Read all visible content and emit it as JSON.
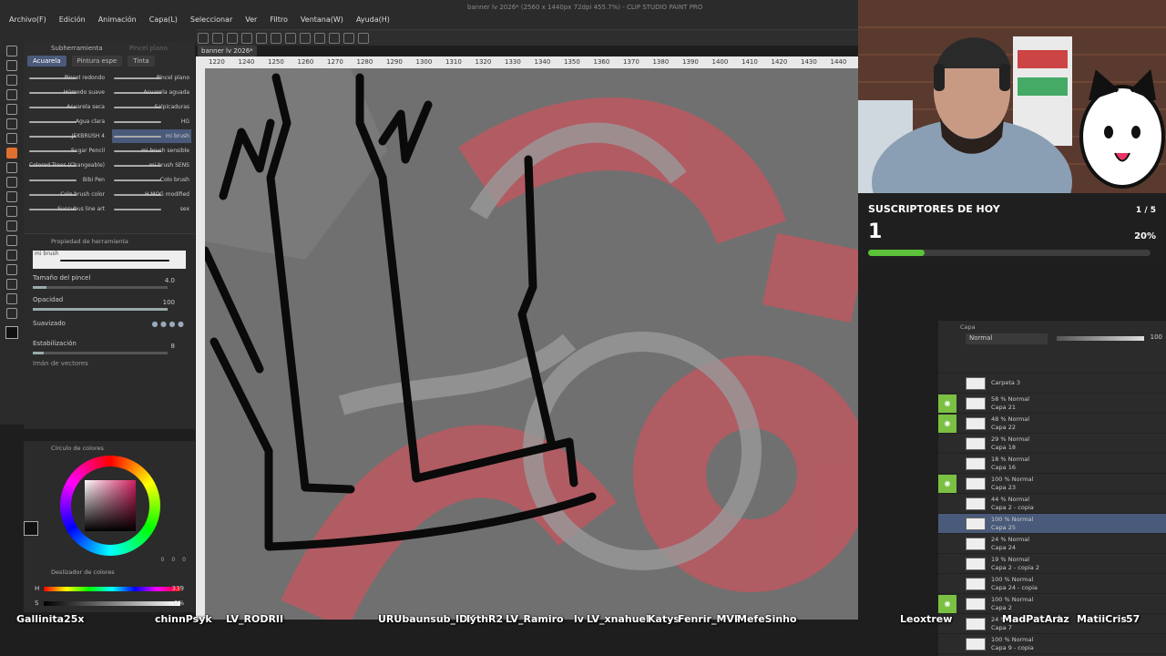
{
  "menubar": {
    "items": [
      "Archivo(F)",
      "Edición",
      "Animación",
      "Capa(L)",
      "Seleccionar",
      "Ver",
      "Filtro",
      "Ventana(W)",
      "Ayuda(H)"
    ],
    "title": "banner lv 2026* (2560 x 1440px 72dpi 455.7%) - CLIP STUDIO PAINT PRO"
  },
  "subtool": {
    "header": "Subherramienta",
    "header2": "Pincel plano",
    "tabs": [
      "Acuarela",
      "Pintura espe",
      "Tinta"
    ],
    "brushes": [
      {
        "label": "Pincel redondo",
        "sel": false
      },
      {
        "label": "Pincel plano",
        "sel": false
      },
      {
        "label": "Húmedo suave",
        "sel": false
      },
      {
        "label": "Acuarela aguada",
        "sel": false
      },
      {
        "label": "Acuarela seca",
        "sel": false
      },
      {
        "label": "Salpicaduras",
        "sel": false
      },
      {
        "label": "Agua clara",
        "sel": false
      },
      {
        "label": "HG",
        "sel": false
      },
      {
        "label": "JEKBRUSH 4",
        "sel": false
      },
      {
        "label": "mi brush",
        "sel": true
      },
      {
        "label": "Sugar Pencil",
        "sel": false
      },
      {
        "label": "mi brush sensible",
        "sel": false
      },
      {
        "label": "Colored Trees (Changeable)",
        "sel": false
      },
      {
        "label": "mi brush SENS",
        "sel": false
      },
      {
        "label": "Bibi Pen",
        "sel": false
      },
      {
        "label": "Colo brush",
        "sel": false
      },
      {
        "label": "Colo brush color",
        "sel": false
      },
      {
        "label": "H.MOG modified",
        "sel": false
      },
      {
        "label": "Succubus line art",
        "sel": false
      },
      {
        "label": "sex",
        "sel": false
      }
    ]
  },
  "toolprop": {
    "header": "Propiedad de herramienta",
    "brush_name": "mi brush",
    "size_label": "Tamaño del pincel",
    "size_value": "4.0",
    "opacity_label": "Opacidad",
    "opacity_value": "100",
    "smooth_label": "Suavizado",
    "stab_label": "Estabilización",
    "stab_value": "8",
    "vector_label": "Imán de vectores"
  },
  "colorwheel": {
    "header": "Círculo de colores",
    "values": [
      "0",
      "0",
      "0"
    ]
  },
  "colorslider": {
    "header": "Deslizador de colores",
    "h_label": "H",
    "s_label": "S",
    "h_value": "339",
    "s_value": "0%"
  },
  "canvas": {
    "doc_tab": "banner lv 2026*",
    "ruler": [
      "1220",
      "1240",
      "1250",
      "1260",
      "1270",
      "1280",
      "1290",
      "1300",
      "1310",
      "1320",
      "1330",
      "1340",
      "1350",
      "1360",
      "1370",
      "1380",
      "1390",
      "1400",
      "1410",
      "1420",
      "1430",
      "1440"
    ]
  },
  "subs": {
    "title": "SUSCRIPTORES DE HOY",
    "count": "1",
    "goal": "1 / 5",
    "percent": "20%",
    "progress": 0.2
  },
  "layers": {
    "panel_title": "Capa",
    "blend_mode": "Normal",
    "opacity": "100",
    "rows": [
      {
        "mode": "",
        "name": "Carpeta 3",
        "eye": false,
        "sel": false
      },
      {
        "mode": "58 % Normal",
        "name": "Capa 21",
        "eye": true,
        "sel": false
      },
      {
        "mode": "48 % Normal",
        "name": "Capa 22",
        "eye": true,
        "sel": false
      },
      {
        "mode": "29 % Normal",
        "name": "Capa 18",
        "eye": false,
        "sel": false
      },
      {
        "mode": "18 % Normal",
        "name": "Capa 16",
        "eye": false,
        "sel": false
      },
      {
        "mode": "100 % Normal",
        "name": "Capa 23",
        "eye": true,
        "sel": false
      },
      {
        "mode": "44 % Normal",
        "name": "Capa 2 - copia",
        "eye": false,
        "sel": false
      },
      {
        "mode": "100 % Normal",
        "name": "Capa 25",
        "eye": false,
        "sel": true
      },
      {
        "mode": "24 % Normal",
        "name": "Capa 24",
        "eye": false,
        "sel": false
      },
      {
        "mode": "19 % Normal",
        "name": "Capa 2 - copia 2",
        "eye": false,
        "sel": false
      },
      {
        "mode": "100 % Normal",
        "name": "Capa 24 - copia",
        "eye": false,
        "sel": false
      },
      {
        "mode": "100 % Normal",
        "name": "Capa 2",
        "eye": true,
        "sel": false
      },
      {
        "mode": "24 % Normal",
        "name": "Capa 7",
        "eye": false,
        "sel": false
      },
      {
        "mode": "100 % Normal",
        "name": "Capa 9 - copia",
        "eye": false,
        "sel": false
      }
    ]
  },
  "chat_names": [
    "Gallinita25x",
    "chinnPsyk",
    "LV_RODRII",
    "URUbaunsub_IDK",
    "lythR2",
    "LV_Ramiro",
    "lv",
    "LV_xnahuel",
    "Katys",
    "Fenrir_MVP",
    "MefeSinho",
    "Leoxtrew",
    "MadPatArt",
    "az",
    "MatiiCris",
    "57"
  ]
}
